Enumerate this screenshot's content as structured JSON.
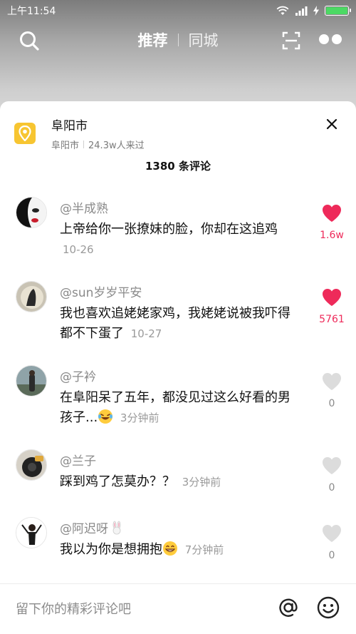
{
  "status_bar": {
    "time": "上午11:54"
  },
  "top_nav": {
    "tab_recommend": "推荐",
    "tab_local": "同城"
  },
  "location": {
    "title": "阜阳市",
    "sub_city": "阜阳市",
    "visitors": "24.3w人来过"
  },
  "comment_count": "1380 条评论",
  "comments": [
    {
      "user": "@半成熟",
      "text": "上帝给你一张撩妹的脸，你却在这追鸡",
      "time": "10-26",
      "likes": "1.6w",
      "liked": true
    },
    {
      "user": "@sun岁岁平安",
      "text": "我也喜欢追姥姥家鸡，我姥姥说被我吓得都不下蛋了",
      "time": "10-27",
      "likes": "5761",
      "liked": true
    },
    {
      "user": "@子衿",
      "text": "在阜阳呆了五年，都没见过这么好看的男孩子...",
      "time": "3分钟前",
      "likes": "0",
      "liked": false,
      "emoji": "laugh-cry"
    },
    {
      "user": "@兰子",
      "text": "踩到鸡了怎莫办？？",
      "time": "3分钟前",
      "likes": "0",
      "liked": false
    },
    {
      "user": "@阿迟呀",
      "text": "我以为你是想拥抱",
      "time": "7分钟前",
      "likes": "0",
      "liked": false,
      "emoji": "grin",
      "user_emoji": "rabbit"
    }
  ],
  "input": {
    "placeholder": "留下你的精彩评论吧"
  },
  "colors": {
    "like_active": "#ee2a5a",
    "like_inactive": "#dcdcdc",
    "location_pin": "#f7c531"
  }
}
